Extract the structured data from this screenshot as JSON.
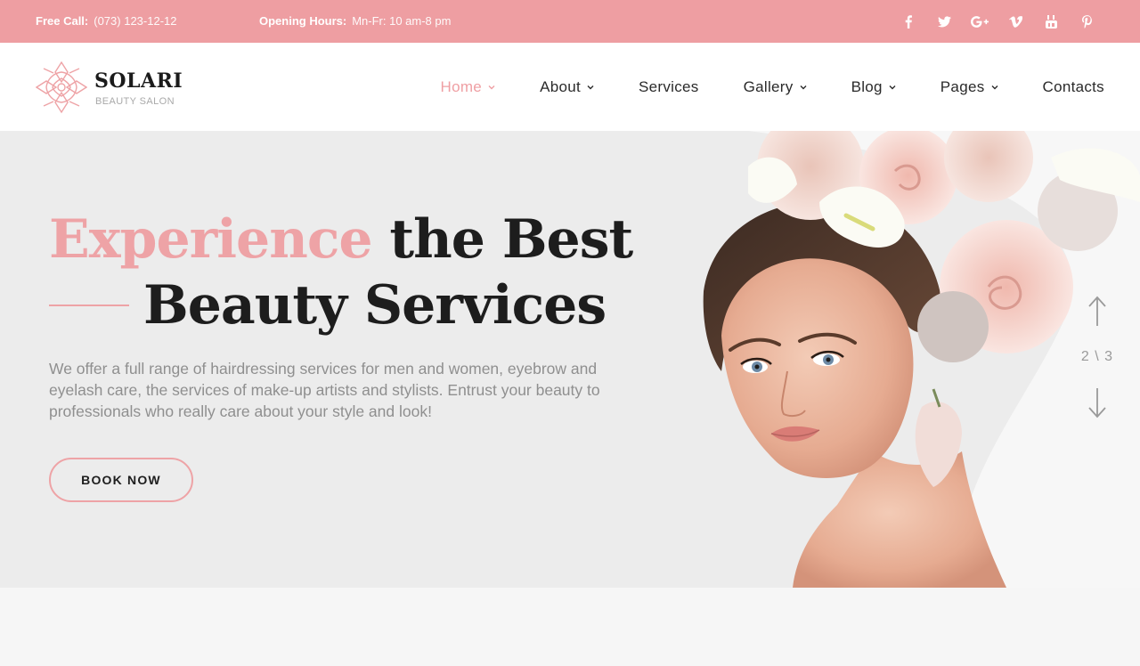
{
  "topbar": {
    "call_label": "Free Call:",
    "call_value": "(073) 123-12-12",
    "hours_label": "Opening Hours:",
    "hours_value": "Mn-Fr: 10 am-8 pm",
    "socials": [
      "facebook-icon",
      "twitter-icon",
      "google-plus-icon",
      "vimeo-icon",
      "youtube-icon",
      "pinterest-icon"
    ]
  },
  "logo": {
    "name": "SOLARI",
    "tagline": "BEAUTY SALON"
  },
  "nav": {
    "items": [
      {
        "label": "Home",
        "dropdown": true,
        "active": true
      },
      {
        "label": "About",
        "dropdown": true,
        "active": false
      },
      {
        "label": "Services",
        "dropdown": false,
        "active": false
      },
      {
        "label": "Gallery",
        "dropdown": true,
        "active": false
      },
      {
        "label": "Blog",
        "dropdown": true,
        "active": false
      },
      {
        "label": "Pages",
        "dropdown": true,
        "active": false
      },
      {
        "label": "Contacts",
        "dropdown": false,
        "active": false
      }
    ]
  },
  "hero": {
    "headline_accent": "Experience",
    "headline_rest": " the Best",
    "headline_line2": "Beauty Services",
    "description": "We offer a full range of hairdressing services for men and women, eyebrow and eyelash care, the services of make-up artists and stylists. Entrust your beauty to professionals who really care about your style and look!",
    "button_label": "BOOK NOW",
    "slide_counter": "2 \\ 3"
  },
  "colors": {
    "accent": "#ee9ea2",
    "hero_bg": "#ececec",
    "text_dark": "#1d1d1d",
    "text_muted": "#8f8f8f"
  }
}
